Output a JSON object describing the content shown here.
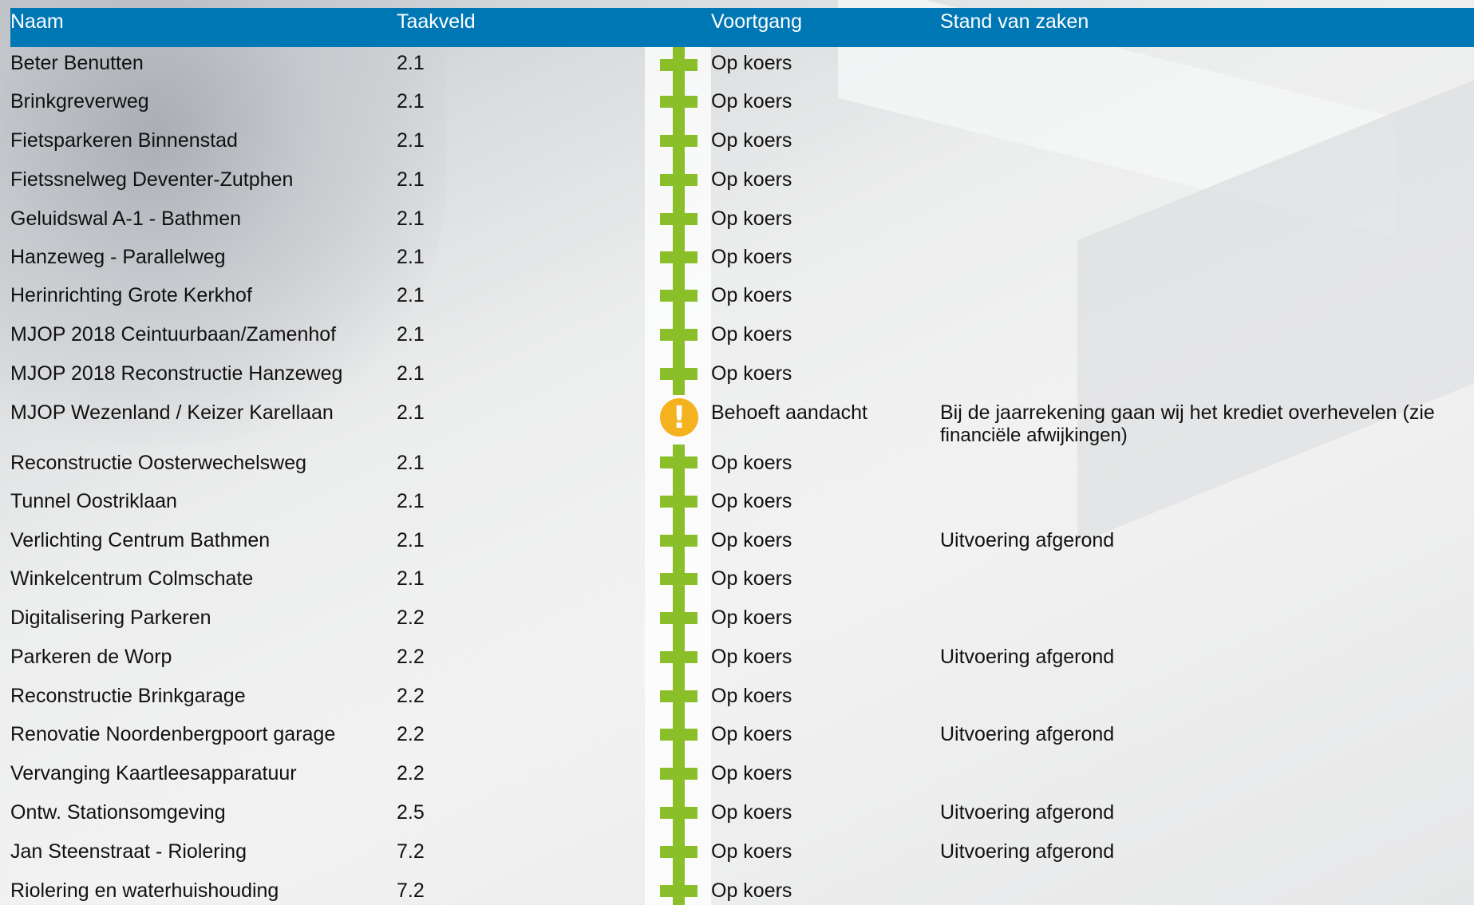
{
  "header": {
    "naam": "Naam",
    "taakveld": "Taakveld",
    "voortgang": "Voortgang",
    "stand": "Stand van zaken"
  },
  "rows": [
    {
      "naam": "Beter Benutten",
      "taakveld": "2.1",
      "voortgang": "Op koers",
      "stand": "",
      "status": "on-track"
    },
    {
      "naam": "Brinkgreverweg",
      "taakveld": "2.1",
      "voortgang": "Op koers",
      "stand": "",
      "status": "on-track"
    },
    {
      "naam": "Fietsparkeren Binnenstad",
      "taakveld": "2.1",
      "voortgang": "Op koers",
      "stand": "",
      "status": "on-track"
    },
    {
      "naam": "Fietssnelweg Deventer-Zutphen",
      "taakveld": "2.1",
      "voortgang": "Op koers",
      "stand": "",
      "status": "on-track"
    },
    {
      "naam": "Geluidswal A-1 - Bathmen",
      "taakveld": "2.1",
      "voortgang": "Op koers",
      "stand": "",
      "status": "on-track"
    },
    {
      "naam": "Hanzeweg - Parallelweg",
      "taakveld": "2.1",
      "voortgang": "Op koers",
      "stand": "",
      "status": "on-track"
    },
    {
      "naam": "Herinrichting Grote Kerkhof",
      "taakveld": "2.1",
      "voortgang": "Op koers",
      "stand": "",
      "status": "on-track"
    },
    {
      "naam": "MJOP 2018 Ceintuurbaan/Zamenhof",
      "taakveld": "2.1",
      "voortgang": "Op koers",
      "stand": "",
      "status": "on-track"
    },
    {
      "naam": "MJOP 2018 Reconstructie Hanzeweg",
      "taakveld": "2.1",
      "voortgang": "Op koers",
      "stand": "",
      "status": "on-track"
    },
    {
      "naam": "MJOP Wezenland / Keizer Karellaan",
      "taakveld": "2.1",
      "voortgang": "Behoeft aandacht",
      "stand": "Bij de jaarrekening gaan wij het krediet overhevelen (zie",
      "stand2": "financiële afwijkingen)",
      "status": "attention"
    },
    {
      "naam": "Reconstructie Oosterwechelsweg",
      "taakveld": "2.1",
      "voortgang": "Op koers",
      "stand": "",
      "status": "on-track"
    },
    {
      "naam": "Tunnel Oostriklaan",
      "taakveld": "2.1",
      "voortgang": "Op koers",
      "stand": "",
      "status": "on-track"
    },
    {
      "naam": "Verlichting Centrum Bathmen",
      "taakveld": "2.1",
      "voortgang": "Op koers",
      "stand": "Uitvoering afgerond",
      "status": "on-track"
    },
    {
      "naam": "Winkelcentrum Colmschate",
      "taakveld": "2.1",
      "voortgang": "Op koers",
      "stand": "",
      "status": "on-track"
    },
    {
      "naam": "Digitalisering Parkeren",
      "taakveld": "2.2",
      "voortgang": "Op koers",
      "stand": "",
      "status": "on-track"
    },
    {
      "naam": "Parkeren de Worp",
      "taakveld": "2.2",
      "voortgang": "Op koers",
      "stand": "Uitvoering afgerond",
      "status": "on-track"
    },
    {
      "naam": "Reconstructie Brinkgarage",
      "taakveld": "2.2",
      "voortgang": "Op koers",
      "stand": "",
      "status": "on-track"
    },
    {
      "naam": "Renovatie Noordenbergpoort garage",
      "taakveld": "2.2",
      "voortgang": "Op koers",
      "stand": "Uitvoering afgerond",
      "status": "on-track"
    },
    {
      "naam": "Vervanging Kaartleesapparatuur",
      "taakveld": "2.2",
      "voortgang": "Op koers",
      "stand": "",
      "status": "on-track"
    },
    {
      "naam": "Ontw. Stationsomgeving",
      "taakveld": "2.5",
      "voortgang": "Op koers",
      "stand": "Uitvoering afgerond",
      "status": "on-track"
    },
    {
      "naam": "Jan Steenstraat - Riolering",
      "taakveld": "7.2",
      "voortgang": "Op koers",
      "stand": "Uitvoering afgerond",
      "status": "on-track"
    },
    {
      "naam": "Riolering en waterhuishouding",
      "taakveld": "7.2",
      "voortgang": "Op koers",
      "stand": "",
      "status": "on-track"
    }
  ],
  "colors": {
    "header_bg": "#0077b5",
    "on_track": "#8bbf2a",
    "attention": "#f4b21e"
  },
  "icons": {
    "on-track": "plus-icon",
    "attention": "exclamation-icon"
  }
}
